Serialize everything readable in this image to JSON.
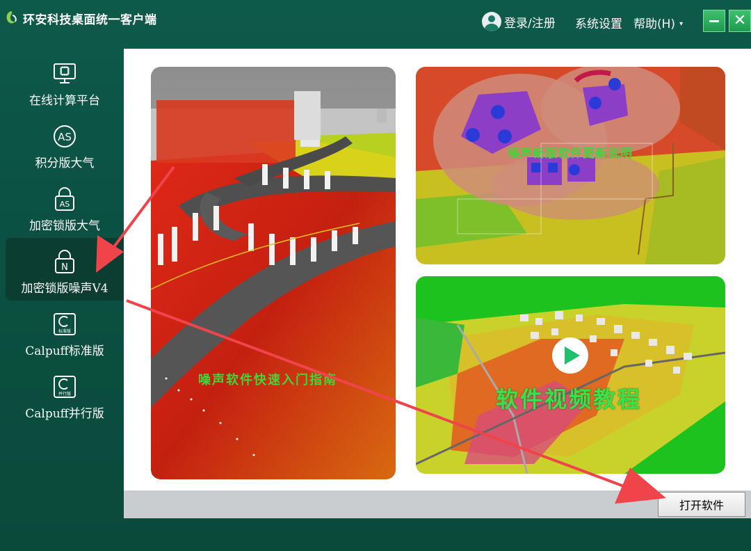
{
  "app": {
    "title": "环安科技桌面统一客户端"
  },
  "header": {
    "login_label": "登录/注册",
    "settings_label": "系统设置",
    "help_label": "帮助(H)",
    "help_caret": "▾"
  },
  "window_controls": {
    "minimize": "minimize-icon",
    "close": "close-icon",
    "close_glyph": "✕"
  },
  "sidebar": {
    "active_index": 3,
    "items": [
      {
        "label": "在线计算平台",
        "icon": "monitor-chip-icon",
        "icon_text": ""
      },
      {
        "label": "积分版大气",
        "icon": "as-circle-icon",
        "icon_text": "AS"
      },
      {
        "label": "加密锁版大气",
        "icon": "lock-as-icon",
        "icon_text": "AS"
      },
      {
        "label": "加密锁版噪声V4",
        "icon": "lock-n-icon",
        "icon_text": "N"
      },
      {
        "label": "Calpuff标准版",
        "icon": "calpuff-standard-icon",
        "icon_text": "标准版"
      },
      {
        "label": "Calpuff并行版",
        "icon": "calpuff-parallel-icon",
        "icon_text": "并行版"
      }
    ]
  },
  "cards": {
    "left": {
      "caption": "噪声软件快速入门指南"
    },
    "top_right": {
      "caption": "噪声新版软件更新说明"
    },
    "bottom_right": {
      "caption": "软件视频教程"
    }
  },
  "footer": {
    "open_button": "打开软件"
  },
  "colors": {
    "accent": "#0b5141",
    "active_item": "#0b3d30",
    "arrow": "#f0444b",
    "caption_green": "#44d33a"
  }
}
